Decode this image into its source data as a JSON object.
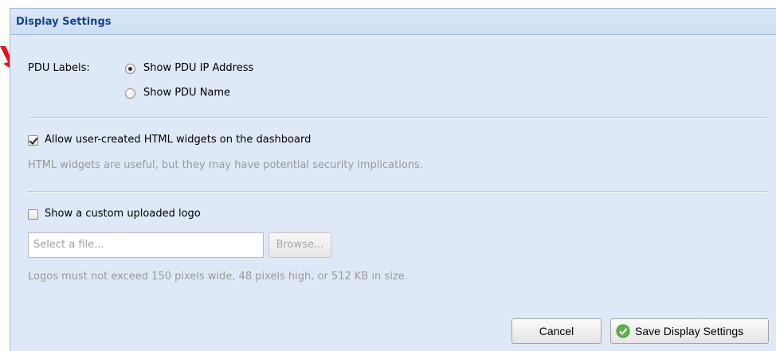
{
  "panel": {
    "title": "Display Settings"
  },
  "pdu_labels": {
    "label": "PDU Labels:",
    "options": [
      {
        "label": "Show PDU IP Address",
        "selected": true
      },
      {
        "label": "Show PDU Name",
        "selected": false
      }
    ]
  },
  "html_widgets": {
    "label": "Allow user-created HTML widgets on the dashboard",
    "checked": true,
    "hint": "HTML widgets are useful, but they may have potential security implications."
  },
  "custom_logo": {
    "label": "Show a custom uploaded logo",
    "checked": false,
    "file_placeholder": "Select a file...",
    "browse_label": "Browse...",
    "hint": "Logos must not exceed 150 pixels wide, 48 pixels high, or 512 KB in size."
  },
  "footer": {
    "cancel_label": "Cancel",
    "save_label": "Save Display Settings",
    "save_icon": "check-circle-icon"
  },
  "colors": {
    "panel_bg": "#dfe8f6",
    "header_text": "#15428b",
    "annotation_arrow": "#e8121b"
  }
}
